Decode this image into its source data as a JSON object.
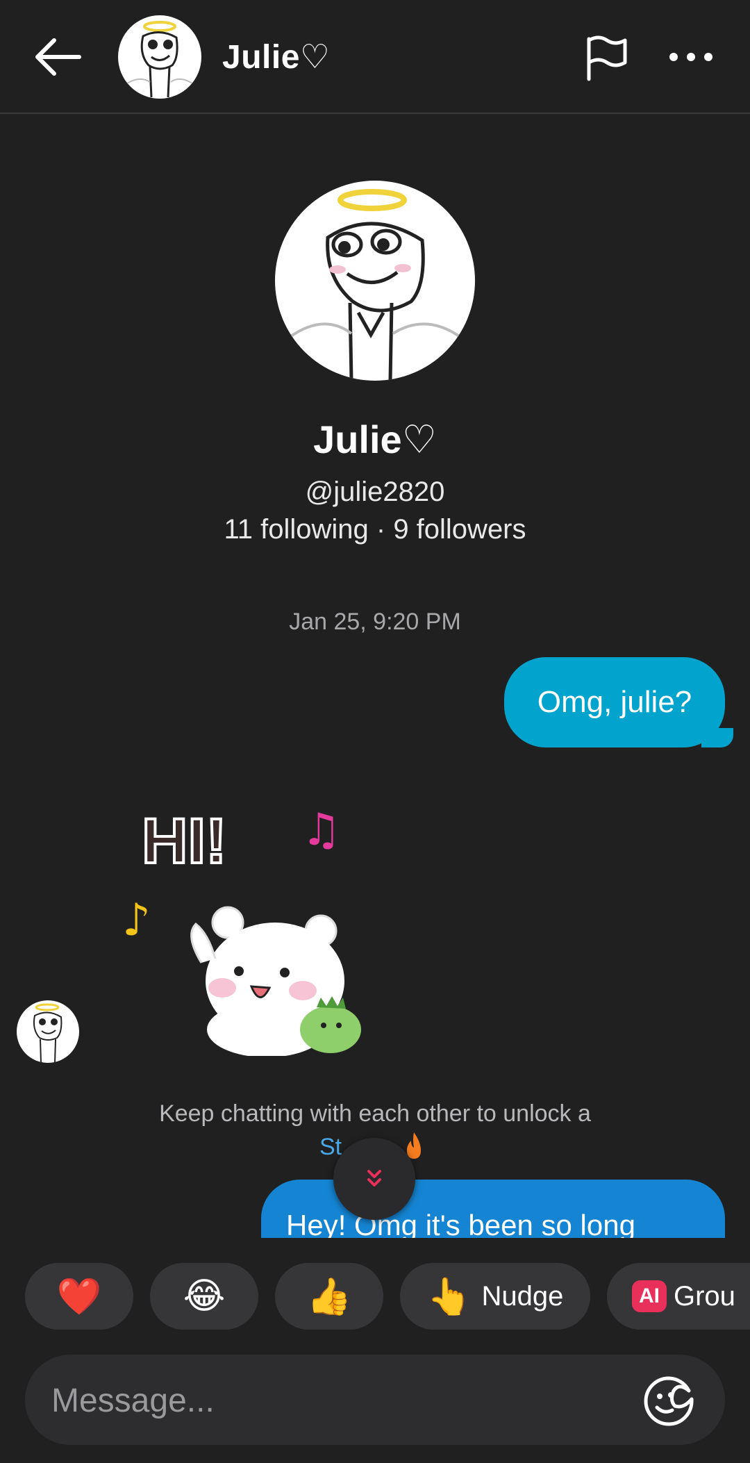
{
  "header": {
    "name": "Julie♡",
    "icons": {
      "back": "arrow-left-icon",
      "report": "flag-icon",
      "more": "more-dots-icon"
    }
  },
  "profile": {
    "name": "Julie♡",
    "handle": "@julie2820",
    "stats": "11 following · 9 followers"
  },
  "chat": {
    "timestamp": "Jan 25, 9:20 PM",
    "messages": [
      {
        "from": "me",
        "text": "Omg, julie?"
      },
      {
        "from": "julie",
        "type": "sticker",
        "text": "HI!"
      },
      {
        "from": "me",
        "text": "Hey! Omg it's been so long"
      }
    ],
    "notice_line1": "Keep chatting with each other to unlock a",
    "notice_line2": "St"
  },
  "quick_actions": [
    {
      "emoji": "❤️",
      "label": ""
    },
    {
      "emoji": "😂",
      "label": ""
    },
    {
      "emoji": "👍",
      "label": ""
    },
    {
      "emoji": "👆",
      "label": "Nudge"
    },
    {
      "badge": "AI",
      "label": "Grou"
    }
  ],
  "composer": {
    "placeholder": "Message..."
  },
  "colors": {
    "background": "#202021",
    "outgoing_bubble": "#02a3cc",
    "outgoing_bubble_2": "#1585d3",
    "ai_badge": "#e8305a",
    "streak_link": "#4aa8e8"
  }
}
